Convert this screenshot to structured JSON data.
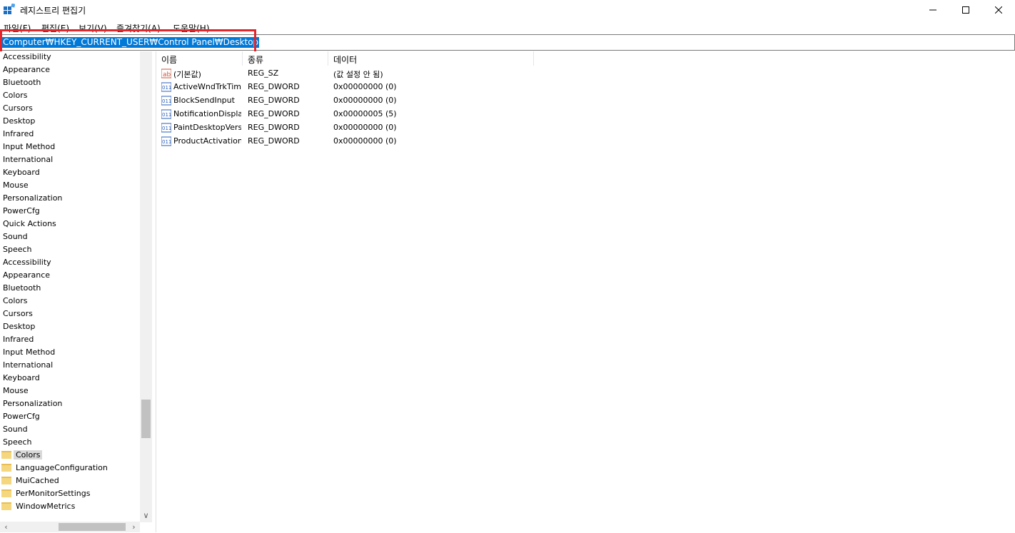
{
  "window": {
    "title": "레지스트리 편집기",
    "controls": {
      "minimize": "—",
      "maximize": "☐",
      "close": "✕"
    }
  },
  "menu": [
    "파일(F)",
    "편집(E)",
    "보기(V)",
    "즐겨찾기(A)",
    "도움말(H)"
  ],
  "address": {
    "path": "Computer₩HKEY_CURRENT_USER₩Control Panel₩Desktop"
  },
  "tree": {
    "items": [
      "Accessibility",
      "Appearance",
      "Bluetooth",
      "Colors",
      "Cursors",
      "Desktop",
      "Infrared",
      "Input Method",
      "International",
      "Keyboard",
      "Mouse",
      "Personalization",
      "PowerCfg",
      "Quick Actions",
      "Sound",
      "Speech",
      "Accessibility",
      "Appearance",
      "Bluetooth",
      "Colors",
      "Cursors",
      "Desktop",
      "Infrared",
      "Input Method",
      "International",
      "Keyboard",
      "Mouse",
      "Personalization",
      "PowerCfg",
      "Sound",
      "Speech"
    ],
    "children": [
      "Colors",
      "LanguageConfiguration",
      "MuiCached",
      "PerMonitorSettings",
      "WindowMetrics"
    ],
    "selected": "Colors"
  },
  "list": {
    "columns": [
      "이름",
      "종류",
      "데이터"
    ],
    "rows": [
      {
        "icon": "string-value-icon",
        "name": "(기본값)",
        "type": "REG_SZ",
        "data": "(값 설정 안 됨)"
      },
      {
        "icon": "binary-value-icon",
        "name": "ActiveWndTrkTimeout",
        "type": "REG_DWORD",
        "data": "0x00000000 (0)"
      },
      {
        "icon": "binary-value-icon",
        "name": "BlockSendInput",
        "type": "REG_DWORD",
        "data": "0x00000000 (0)"
      },
      {
        "icon": "binary-value-icon",
        "name": "NotificationDisplayTime",
        "type": "REG_DWORD",
        "data": "0x00000005 (5)"
      },
      {
        "icon": "binary-value-icon",
        "name": "PaintDesktopVersion",
        "type": "REG_DWORD",
        "data": "0x00000000 (0)"
      },
      {
        "icon": "binary-value-icon",
        "name": "ProductActivationInfo",
        "type": "REG_DWORD",
        "data": "0x00000000 (0)"
      }
    ]
  },
  "colors": {
    "selection": "#0078d7",
    "highlight_border": "#e3242b"
  }
}
